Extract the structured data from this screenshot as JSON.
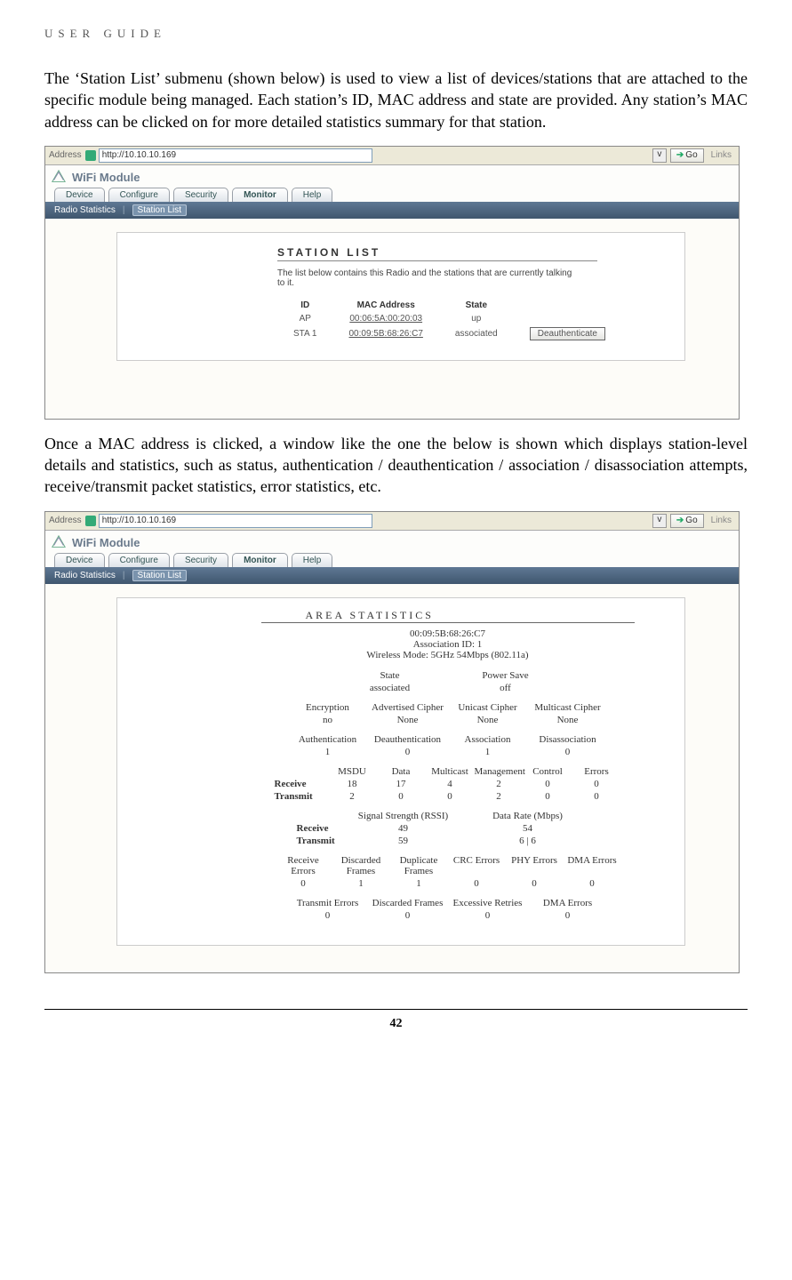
{
  "header": "USER GUIDE",
  "para1": "The ‘Station List’ submenu (shown below) is used to view a list of devices/stations that are attached to the specific module being managed. Each station’s ID, MAC address and state are provided. Any station’s MAC address can be clicked on for more detailed statistics summary for that station.",
  "para2": "Once a MAC address is clicked, a window like the one the below is shown which displays station-level details and statistics, such as status, authentication / deauthentication / association / disassociation attempts, receive/transmit packet statistics, error statistics, etc.",
  "pagenum": "42",
  "browser": {
    "addr_label": "Address",
    "url": "http://10.10.10.169",
    "go": "Go",
    "links": "Links"
  },
  "module_title": "WiFi Module",
  "tabs": {
    "device": "Device",
    "configure": "Configure",
    "security": "Security",
    "monitor": "Monitor",
    "help": "Help"
  },
  "subnav": {
    "radio": "Radio Statistics",
    "station": "Station List"
  },
  "shot1": {
    "title": "STATION LIST",
    "desc": "The list below contains this Radio and the stations that are currently talking to it.",
    "h_id": "ID",
    "h_mac": "MAC Address",
    "h_state": "State",
    "r1_id": "AP",
    "r1_mac": "00:06:5A:00:20:03",
    "r1_state": "up",
    "r2_id": "STA 1",
    "r2_mac": "00:09:5B:68:26:C7",
    "r2_state": "associated",
    "deauth": "Deauthenticate"
  },
  "shot2": {
    "title": "AREA STATISTICS",
    "mac": "00:09:5B:68:26:C7",
    "assoc_id": "Association ID: 1",
    "mode": "Wireless Mode: 5GHz 54Mbps (802.11a)",
    "state_lbl": "State",
    "state_val": "associated",
    "ps_lbl": "Power Save",
    "ps_val": "off",
    "enc_lbl": "Encryption",
    "enc_val": "no",
    "adv_lbl": "Advertised Cipher",
    "adv_val": "None",
    "uni_lbl": "Unicast Cipher",
    "uni_val": "None",
    "mul_lbl": "Multicast Cipher",
    "mul_val": "None",
    "auth_lbl": "Authentication",
    "auth_val": "1",
    "deauth_lbl": "Deauthentication",
    "deauth_val": "0",
    "assoc_lbl": "Association",
    "assoc_val": "1",
    "disassoc_lbl": "Disassociation",
    "disassoc_val": "0",
    "c_msdu": "MSDU",
    "c_data": "Data",
    "c_multi": "Multicast",
    "c_mgmt": "Management",
    "c_ctrl": "Control",
    "c_err": "Errors",
    "rx_lbl": "Receive",
    "rx_msdu": "18",
    "rx_data": "17",
    "rx_multi": "4",
    "rx_mgmt": "2",
    "rx_ctrl": "0",
    "rx_err": "0",
    "tx_lbl": "Transmit",
    "tx_msdu": "2",
    "tx_data": "0",
    "tx_multi": "0",
    "tx_mgmt": "2",
    "tx_ctrl": "0",
    "tx_err": "0",
    "ss_lbl": "Signal Strength (RSSI)",
    "dr_lbl": "Data Rate (Mbps)",
    "ss_rx": "49",
    "dr_rx": "54",
    "ss_tx": "59",
    "dr_tx": "6 | 6",
    "re_lbl": "Receive Errors",
    "df_lbl": "Discarded Frames",
    "dup_lbl": "Duplicate Frames",
    "crc_lbl": "CRC Errors",
    "phy_lbl": "PHY Errors",
    "dma_lbl": "DMA Errors",
    "re_v": "0",
    "df_v": "1",
    "dup_v": "1",
    "crc_v": "0",
    "phy_v": "0",
    "dma_v": "0",
    "te_lbl": "Transmit Errors",
    "df2_lbl": "Discarded Frames",
    "ex_lbl": "Excessive Retries",
    "dma2_lbl": "DMA Errors",
    "te_v": "0",
    "df2_v": "0",
    "ex_v": "0",
    "dma2_v": "0"
  }
}
